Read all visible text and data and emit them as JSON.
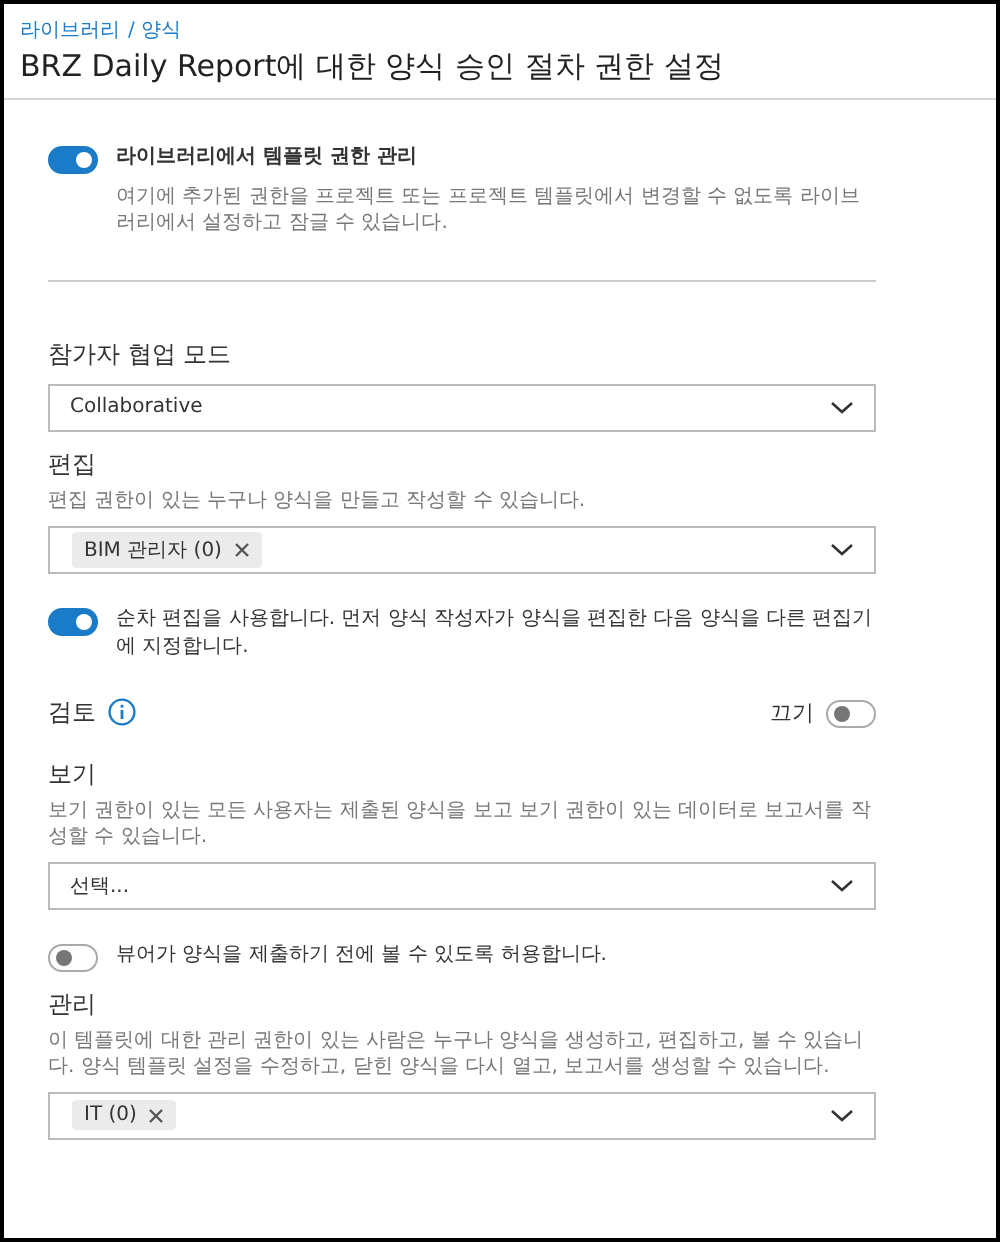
{
  "breadcrumb": [
    "라이브러리",
    "/ 양식"
  ],
  "title": "BRZ Daily Report에 대한 양식 승인 절차 권한 설정",
  "library_toggle": {
    "on": true,
    "label": "라이브러리에서 템플릿 권한 관리",
    "description": "여기에 추가된 권한을 프로젝트 또는 프로젝트 템플릿에서 변경할 수 없도록 라이브러리에서 설정하고 잠글 수 있습니다."
  },
  "collaboration": {
    "label": "참가자 협업 모드",
    "value": "Collaborative"
  },
  "edit": {
    "label": "편집",
    "description": "편집 권한이 있는 누구나 양식을 만들고 작성할 수 있습니다.",
    "tags": [
      {
        "label": "BIM 관리자 (0)"
      }
    ],
    "toggle": {
      "on": true,
      "label": "순차 편집을 사용합니다. 먼저 양식 작성자가 양식을 편집한 다음 양식을 다른 편집기에 지정합니다."
    }
  },
  "review": {
    "label": "검토",
    "toggle": {
      "on": false,
      "label": "끄기"
    }
  },
  "view": {
    "label": "보기",
    "description": "보기 권한이 있는 모든 사용자는 제출된 양식을 보고 보기 권한이 있는 데이터로 보고서를 작성할 수 있습니다.",
    "placeholder": "선택...",
    "toggle": {
      "on": false,
      "label": "뷰어가 양식을 제출하기 전에 볼 수 있도록 허용합니다."
    }
  },
  "manage": {
    "label": "관리",
    "description": "이 템플릿에 대한 관리 권한이 있는 사람은 누구나 양식을 생성하고, 편집하고, 볼 수 있습니다. 양식 템플릿 설정을 수정하고, 닫힌 양식을 다시 열고, 보고서를 생성할 수 있습니다.",
    "tags": [
      {
        "label": "IT (0)"
      }
    ]
  }
}
